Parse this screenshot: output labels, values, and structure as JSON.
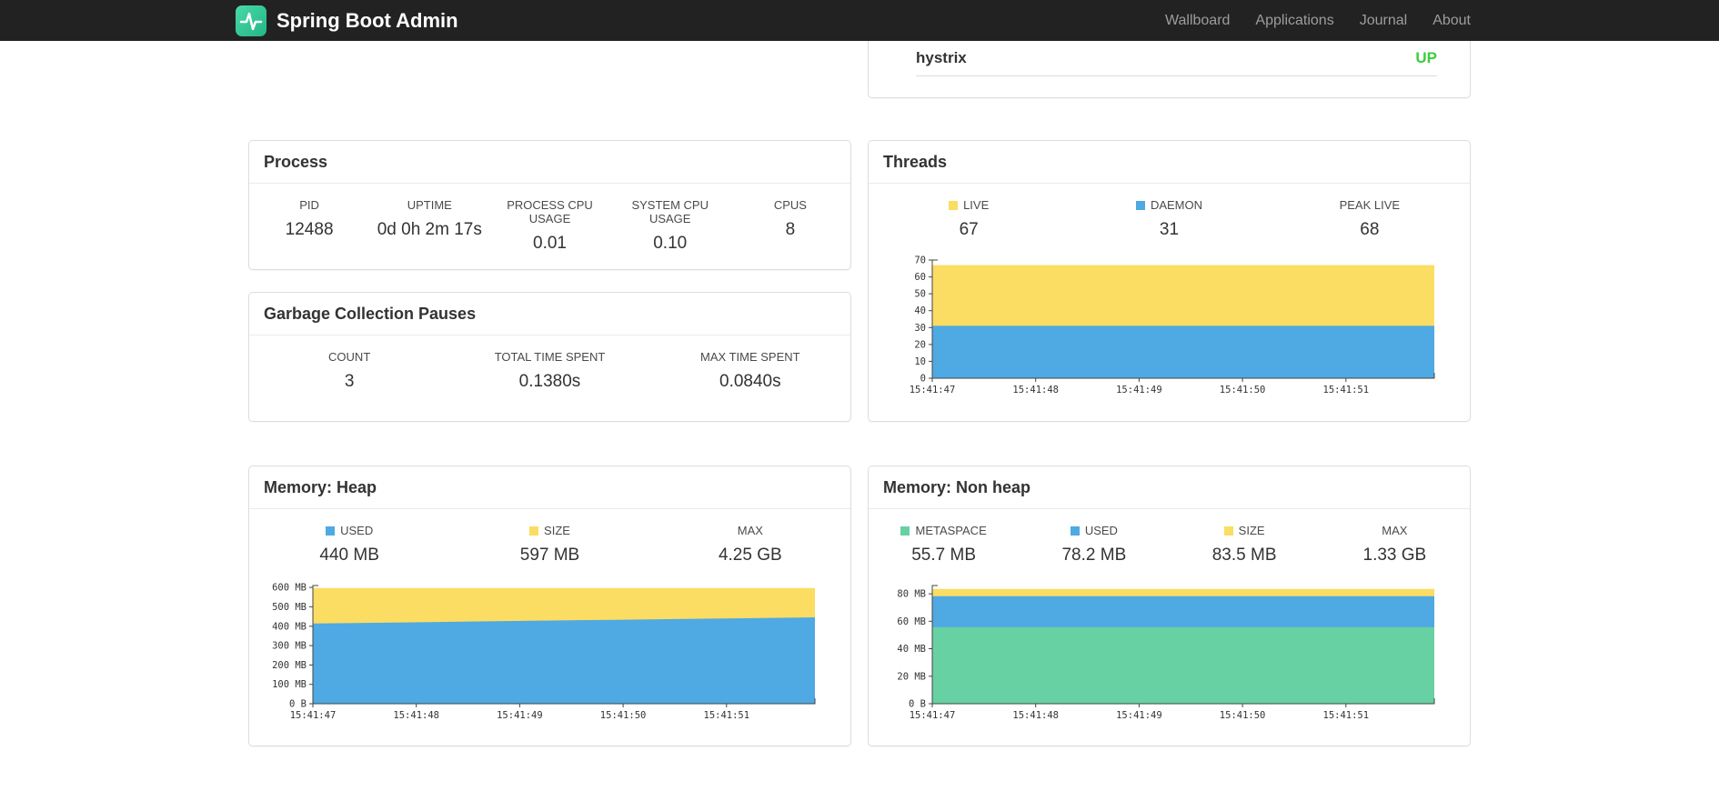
{
  "navbar": {
    "brand": "Spring Boot Admin",
    "items": [
      "Wallboard",
      "Applications",
      "Journal",
      "About"
    ]
  },
  "status_panel": {
    "application": "hystrix",
    "status": "UP",
    "status_color": "#3dcc3d"
  },
  "panels": {
    "process": {
      "title": "Process",
      "stats": [
        {
          "label": "PID",
          "value": "12488"
        },
        {
          "label": "UPTIME",
          "value": "0d 0h 2m 17s"
        },
        {
          "label": "PROCESS CPU USAGE",
          "value": "0.01"
        },
        {
          "label": "SYSTEM CPU USAGE",
          "value": "0.10"
        },
        {
          "label": "CPUS",
          "value": "8"
        }
      ]
    },
    "gc": {
      "title": "Garbage Collection Pauses",
      "stats": [
        {
          "label": "COUNT",
          "value": "3"
        },
        {
          "label": "TOTAL TIME SPENT",
          "value": "0.1380s"
        },
        {
          "label": "MAX TIME SPENT",
          "value": "0.0840s"
        }
      ]
    },
    "threads": {
      "title": "Threads",
      "stats": [
        {
          "label": "LIVE",
          "value": "67",
          "swatch": "#fadd62"
        },
        {
          "label": "DAEMON",
          "value": "31",
          "swatch": "#4fa9e3"
        },
        {
          "label": "PEAK LIVE",
          "value": "68"
        }
      ]
    },
    "memory_heap": {
      "title": "Memory: Heap",
      "stats": [
        {
          "label": "USED",
          "value": "440 MB",
          "swatch": "#4fa9e3"
        },
        {
          "label": "SIZE",
          "value": "597 MB",
          "swatch": "#fadd62"
        },
        {
          "label": "MAX",
          "value": "4.25 GB"
        }
      ]
    },
    "memory_nonheap": {
      "title": "Memory: Non heap",
      "stats": [
        {
          "label": "METASPACE",
          "value": "55.7 MB",
          "swatch": "#67d1a3"
        },
        {
          "label": "USED",
          "value": "78.2 MB",
          "swatch": "#4fa9e3"
        },
        {
          "label": "SIZE",
          "value": "83.5 MB",
          "swatch": "#fadd62"
        },
        {
          "label": "MAX",
          "value": "1.33 GB"
        }
      ]
    }
  },
  "colors": {
    "accent_teal": "#3ecf9e",
    "yellow": "#fadd62",
    "blue": "#4fa9e3",
    "green": "#67d1a3",
    "up_green": "#3dcc3d"
  },
  "chart_data": [
    {
      "type": "area",
      "title": "Threads",
      "x_labels": [
        "15:41:47",
        "15:41:48",
        "15:41:49",
        "15:41:50",
        "15:41:51"
      ],
      "ylim": [
        0,
        70
      ],
      "grid": false,
      "legend_position": "top",
      "y_ticks": [
        {
          "v": 0,
          "label": "0"
        },
        {
          "v": 10,
          "label": "10"
        },
        {
          "v": 20,
          "label": "20"
        },
        {
          "v": 30,
          "label": "30"
        },
        {
          "v": 40,
          "label": "40"
        },
        {
          "v": 50,
          "label": "50"
        },
        {
          "v": 60,
          "label": "60"
        },
        {
          "v": 70,
          "label": "70"
        }
      ],
      "series": [
        {
          "name": "LIVE",
          "color": "#fadd62",
          "values": [
            67,
            67,
            67,
            67,
            67,
            67
          ]
        },
        {
          "name": "DAEMON",
          "color": "#4fa9e3",
          "values": [
            31,
            31,
            31,
            31,
            31,
            31
          ]
        }
      ]
    },
    {
      "type": "area",
      "title": "Memory: Heap (MB)",
      "x_labels": [
        "15:41:47",
        "15:41:48",
        "15:41:49",
        "15:41:50",
        "15:41:51"
      ],
      "ylim": [
        0,
        610
      ],
      "grid": false,
      "legend_position": "top",
      "y_ticks": [
        {
          "v": 0,
          "label": "0 B"
        },
        {
          "v": 100,
          "label": "100 MB"
        },
        {
          "v": 200,
          "label": "200 MB"
        },
        {
          "v": 300,
          "label": "300 MB"
        },
        {
          "v": 400,
          "label": "400 MB"
        },
        {
          "v": 500,
          "label": "500 MB"
        },
        {
          "v": 600,
          "label": "600 MB"
        }
      ],
      "series": [
        {
          "name": "USED",
          "color": "#4fa9e3",
          "values": [
            414,
            420,
            427,
            433,
            439,
            446
          ]
        },
        {
          "name": "SIZE",
          "color": "#fadd62",
          "values": [
            597,
            597,
            597,
            597,
            597,
            597
          ]
        }
      ]
    },
    {
      "type": "area",
      "title": "Memory: Non heap (MB)",
      "x_labels": [
        "15:41:47",
        "15:41:48",
        "15:41:49",
        "15:41:50",
        "15:41:51"
      ],
      "ylim": [
        0,
        86
      ],
      "grid": false,
      "legend_position": "top",
      "y_ticks": [
        {
          "v": 0,
          "label": "0 B"
        },
        {
          "v": 20,
          "label": "20 MB"
        },
        {
          "v": 40,
          "label": "40 MB"
        },
        {
          "v": 60,
          "label": "60 MB"
        },
        {
          "v": 80,
          "label": "80 MB"
        }
      ],
      "series": [
        {
          "name": "METASPACE",
          "color": "#67d1a3",
          "values": [
            55.7,
            55.7,
            55.7,
            55.7,
            55.7,
            55.7
          ]
        },
        {
          "name": "USED",
          "color": "#4fa9e3",
          "values": [
            78.2,
            78.2,
            78.2,
            78.2,
            78.2,
            78.2
          ]
        },
        {
          "name": "SIZE",
          "color": "#fadd62",
          "values": [
            83.5,
            83.5,
            83.5,
            83.5,
            83.5,
            83.5
          ]
        }
      ]
    }
  ]
}
